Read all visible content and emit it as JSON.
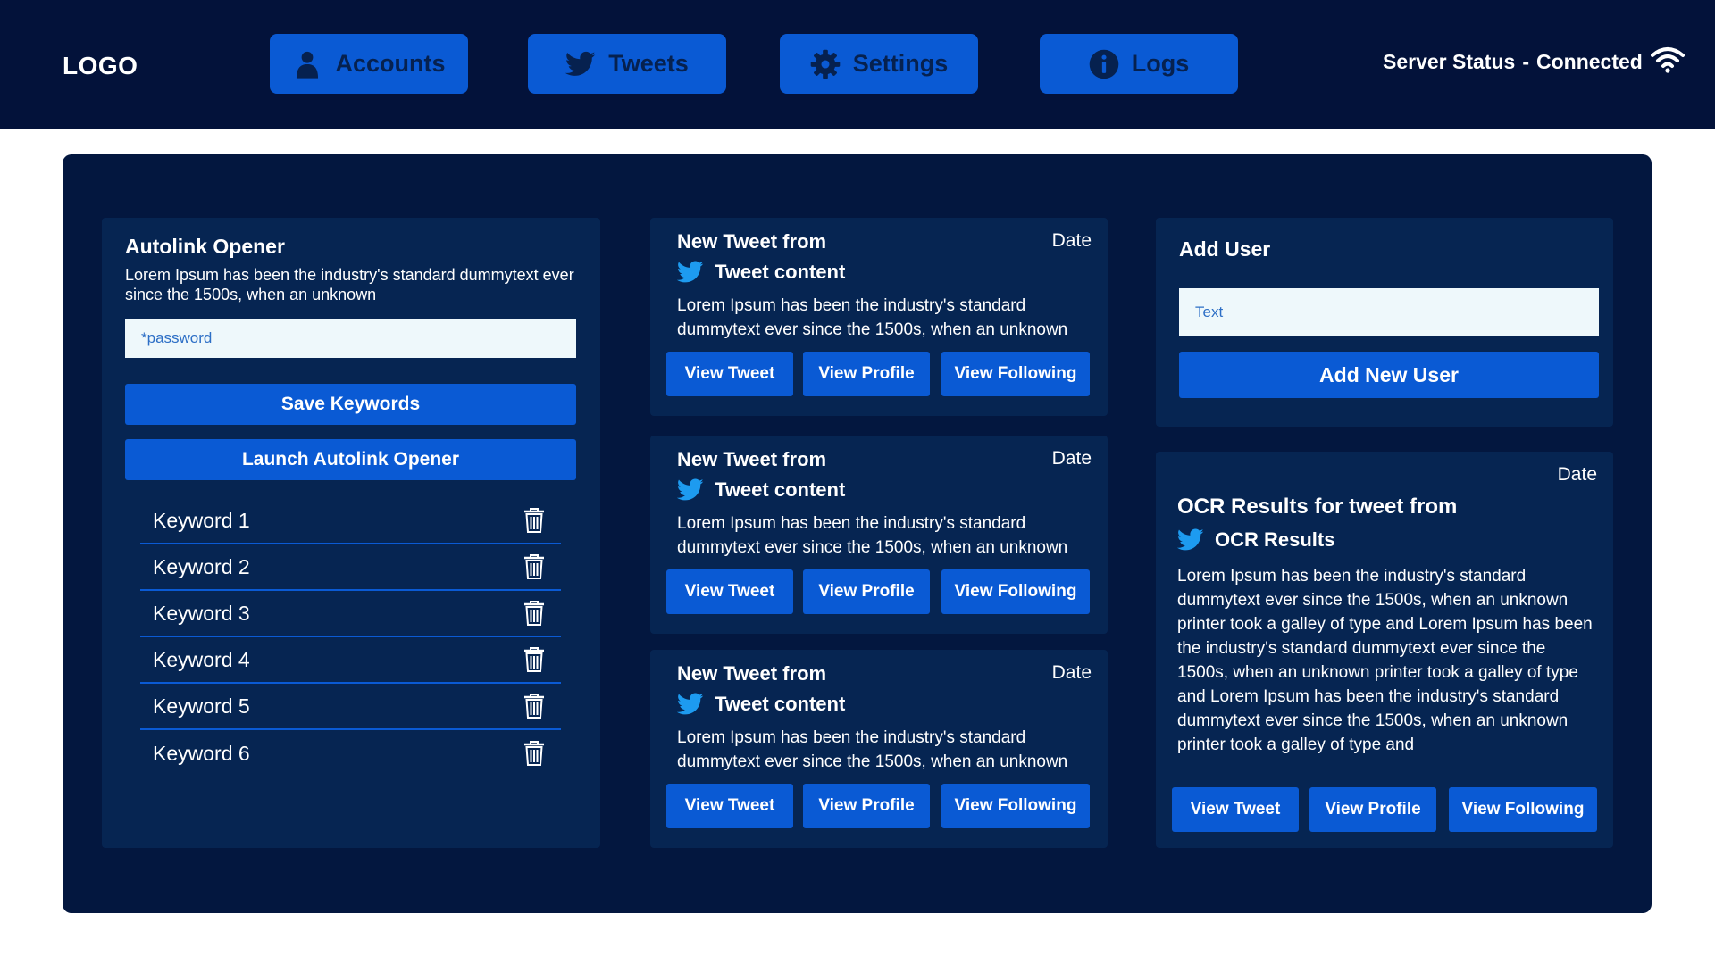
{
  "colors": {
    "topbar": "#03123a",
    "panel": "#03173f",
    "card": "#062552",
    "accent": "#0a5ad4",
    "input_bg": "#eef8fb",
    "nav_text": "#06214f"
  },
  "header": {
    "logo": "LOGO",
    "nav": [
      {
        "label": "Accounts",
        "icon": "user-icon"
      },
      {
        "label": "Tweets",
        "icon": "twitter-bird-icon"
      },
      {
        "label": "Settings",
        "icon": "gear-icon"
      },
      {
        "label": "Logs",
        "icon": "info-icon"
      }
    ],
    "status_label": "Server Status",
    "status_separator": "-",
    "status_value": "Connected",
    "status_icon": "wifi-icon"
  },
  "autolink": {
    "title": "Autolink Opener",
    "description": "Lorem Ipsum has been the industry's standard dummytext ever since the 1500s, when an unknown",
    "password_placeholder": "*password",
    "save_label": "Save Keywords",
    "launch_label": "Launch Autolink Opener",
    "keywords": [
      "Keyword 1",
      "Keyword 2",
      "Keyword 3",
      "Keyword 4",
      "Keyword 5",
      "Keyword 6"
    ]
  },
  "tweets": [
    {
      "from": "New Tweet from",
      "date": "Date",
      "content_title": "Tweet content",
      "body": "Lorem Ipsum has been the industry's standard dummytext ever since the 1500s, when an unknown",
      "view_tweet": "View Tweet",
      "view_profile": "View Profile",
      "view_following": "View Following"
    },
    {
      "from": "New Tweet from",
      "date": "Date",
      "content_title": "Tweet content",
      "body": "Lorem Ipsum has been the industry's standard dummytext ever since the 1500s, when an unknown",
      "view_tweet": "View Tweet",
      "view_profile": "View Profile",
      "view_following": "View Following"
    },
    {
      "from": "New Tweet from",
      "date": "Date",
      "content_title": "Tweet content",
      "body": "Lorem Ipsum has been the industry's standard dummytext ever since the 1500s, when an unknown",
      "view_tweet": "View Tweet",
      "view_profile": "View Profile",
      "view_following": "View Following"
    }
  ],
  "add_user": {
    "title": "Add User",
    "input_placeholder": "Text",
    "button_label": "Add New User"
  },
  "ocr": {
    "date": "Date",
    "title": "OCR Results for tweet from",
    "results_label": "OCR Results",
    "body": "Lorem Ipsum has been the industry's standard dummytext ever since the 1500s, when an unknown printer took a galley of type and Lorem Ipsum has been the industry's standard dummytext ever since  the 1500s, when an unknown printer took a galley of type and Lorem Ipsum has been the industry's standard dummytext ever since the 1500s, when an unknown printer took a galley of type and",
    "view_tweet": "View Tweet",
    "view_profile": "View Profile",
    "view_following": "View Following"
  }
}
